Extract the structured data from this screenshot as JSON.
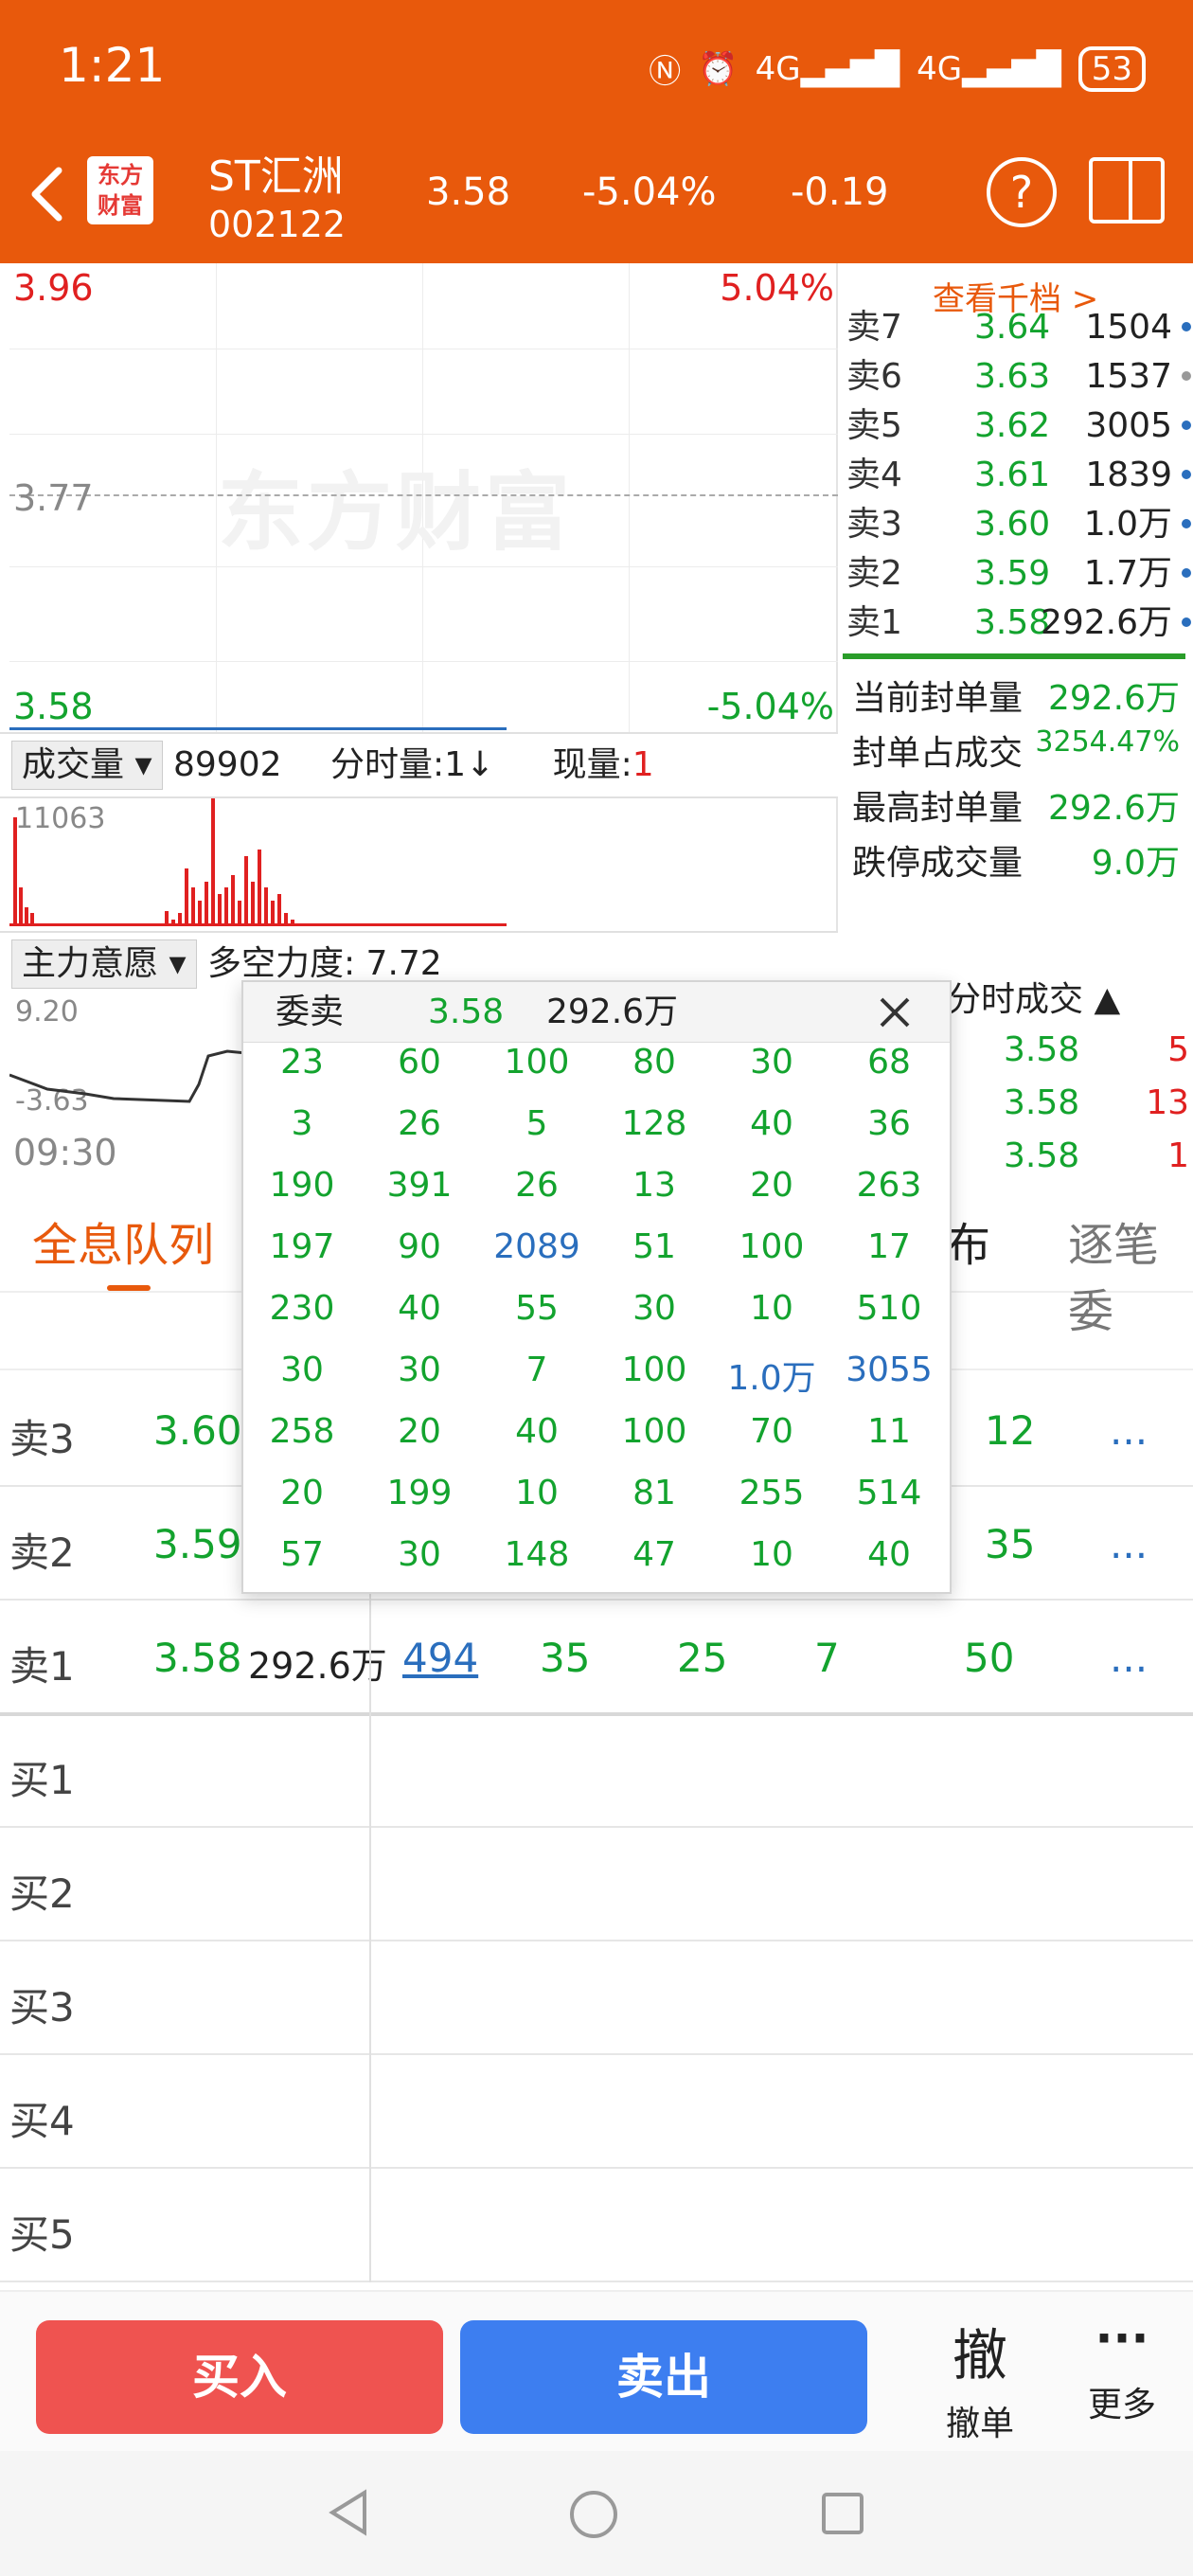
{
  "status": {
    "time": "1:21",
    "battery": "53",
    "signal1": "4G",
    "signal2": "4G"
  },
  "header": {
    "logo_line1": "东方",
    "logo_line2": "财富",
    "name": "ST汇洲",
    "code": "002122",
    "price": "3.58",
    "pct": "-5.04%",
    "change": "-0.19",
    "help": "?"
  },
  "chart": {
    "top_price": "3.96",
    "top_pct": "5.04%",
    "mid_price": "3.77",
    "bot_price": "3.58",
    "bot_pct": "-5.04%",
    "watermark": "东方财富",
    "volume_label": "成交量",
    "volume_value": "89902",
    "fenshi": "分时量:1↓",
    "xianliang_label": "现量:",
    "xianliang_value": "1",
    "vol_max": "11063",
    "zhuli_label": "主力意愿",
    "duokong": "多空力度: 7.72",
    "ind_top": "9.20",
    "ind_bot": "-3.63",
    "time_start": "09:30",
    "volume_bars": [
      0.85,
      0.3,
      0.15,
      0.1,
      0.12,
      0.05,
      0.1,
      0.45,
      0.3,
      0.2,
      0.35,
      1.0,
      0.25,
      0.3,
      0.4,
      0.2,
      0.55,
      0.35,
      0.6,
      0.3,
      0.2,
      0.25,
      0.1,
      0.05
    ]
  },
  "orderbook": {
    "view_more": "查看千档 >",
    "rows": [
      {
        "label": "卖7",
        "price": "3.64",
        "vol": "1504",
        "dot": "#2a6ebd"
      },
      {
        "label": "卖6",
        "price": "3.63",
        "vol": "1537",
        "dot": "#999999"
      },
      {
        "label": "卖5",
        "price": "3.62",
        "vol": "3005",
        "dot": "#2a6ebd"
      },
      {
        "label": "卖4",
        "price": "3.61",
        "vol": "1839",
        "dot": "#2a6ebd"
      },
      {
        "label": "卖3",
        "price": "3.60",
        "vol": "1.0万",
        "dot": "#2a6ebd"
      },
      {
        "label": "卖2",
        "price": "3.59",
        "vol": "1.7万",
        "dot": "#2a6ebd"
      },
      {
        "label": "卖1",
        "price": "3.58",
        "vol": "292.6万",
        "dot": "#2a6ebd"
      }
    ],
    "stats": [
      {
        "label": "当前封单量",
        "value": "292.6万"
      },
      {
        "label": "封单占成交",
        "value": "3254.47%"
      },
      {
        "label": "最高封单量",
        "value": "292.6万"
      },
      {
        "label": "跌停成交量",
        "value": "9.0万"
      }
    ],
    "fenshi_title": "分时成交",
    "trades": [
      {
        "price": "3.58",
        "vol": "5"
      },
      {
        "price": "3.58",
        "vol": "13"
      },
      {
        "price": "3.58",
        "vol": "1"
      }
    ]
  },
  "tabs": {
    "t1": "全息队列",
    "t2": "布",
    "t3": "逐笔委"
  },
  "queue": {
    "rows": [
      {
        "label": "卖3",
        "price": "3.60",
        "amount": "",
        "cells": [
          "12",
          "..."
        ]
      },
      {
        "label": "卖2",
        "price": "3.59",
        "amount": "",
        "cells": [
          "35",
          "..."
        ]
      },
      {
        "label": "卖1",
        "price": "3.58",
        "amount": "292.6万",
        "cells": [
          "494",
          "35",
          "25",
          "7",
          "50",
          "..."
        ]
      }
    ],
    "buy_labels": [
      "买1",
      "买2",
      "买3",
      "买4",
      "买5"
    ]
  },
  "popup": {
    "title": "委卖",
    "price": "3.58",
    "amount": "292.6万",
    "grid": [
      [
        "23",
        "60",
        "100",
        "80",
        "30",
        "68"
      ],
      [
        "3",
        "26",
        "5",
        "128",
        "40",
        "36"
      ],
      [
        "190",
        "391",
        "26",
        "13",
        "20",
        "263"
      ],
      [
        "197",
        "90",
        "2089",
        "51",
        "100",
        "17"
      ],
      [
        "230",
        "40",
        "55",
        "30",
        "10",
        "510"
      ],
      [
        "30",
        "30",
        "7",
        "100",
        "1.0万",
        "3055"
      ],
      [
        "258",
        "20",
        "40",
        "100",
        "70",
        "11"
      ],
      [
        "20",
        "199",
        "10",
        "81",
        "255",
        "514"
      ],
      [
        "57",
        "30",
        "148",
        "47",
        "10",
        "40"
      ]
    ]
  },
  "bottom": {
    "buy": "买入",
    "sell": "卖出",
    "cancel_icon": "撤",
    "cancel": "撤单",
    "more_icon": "···",
    "more": "更多"
  }
}
